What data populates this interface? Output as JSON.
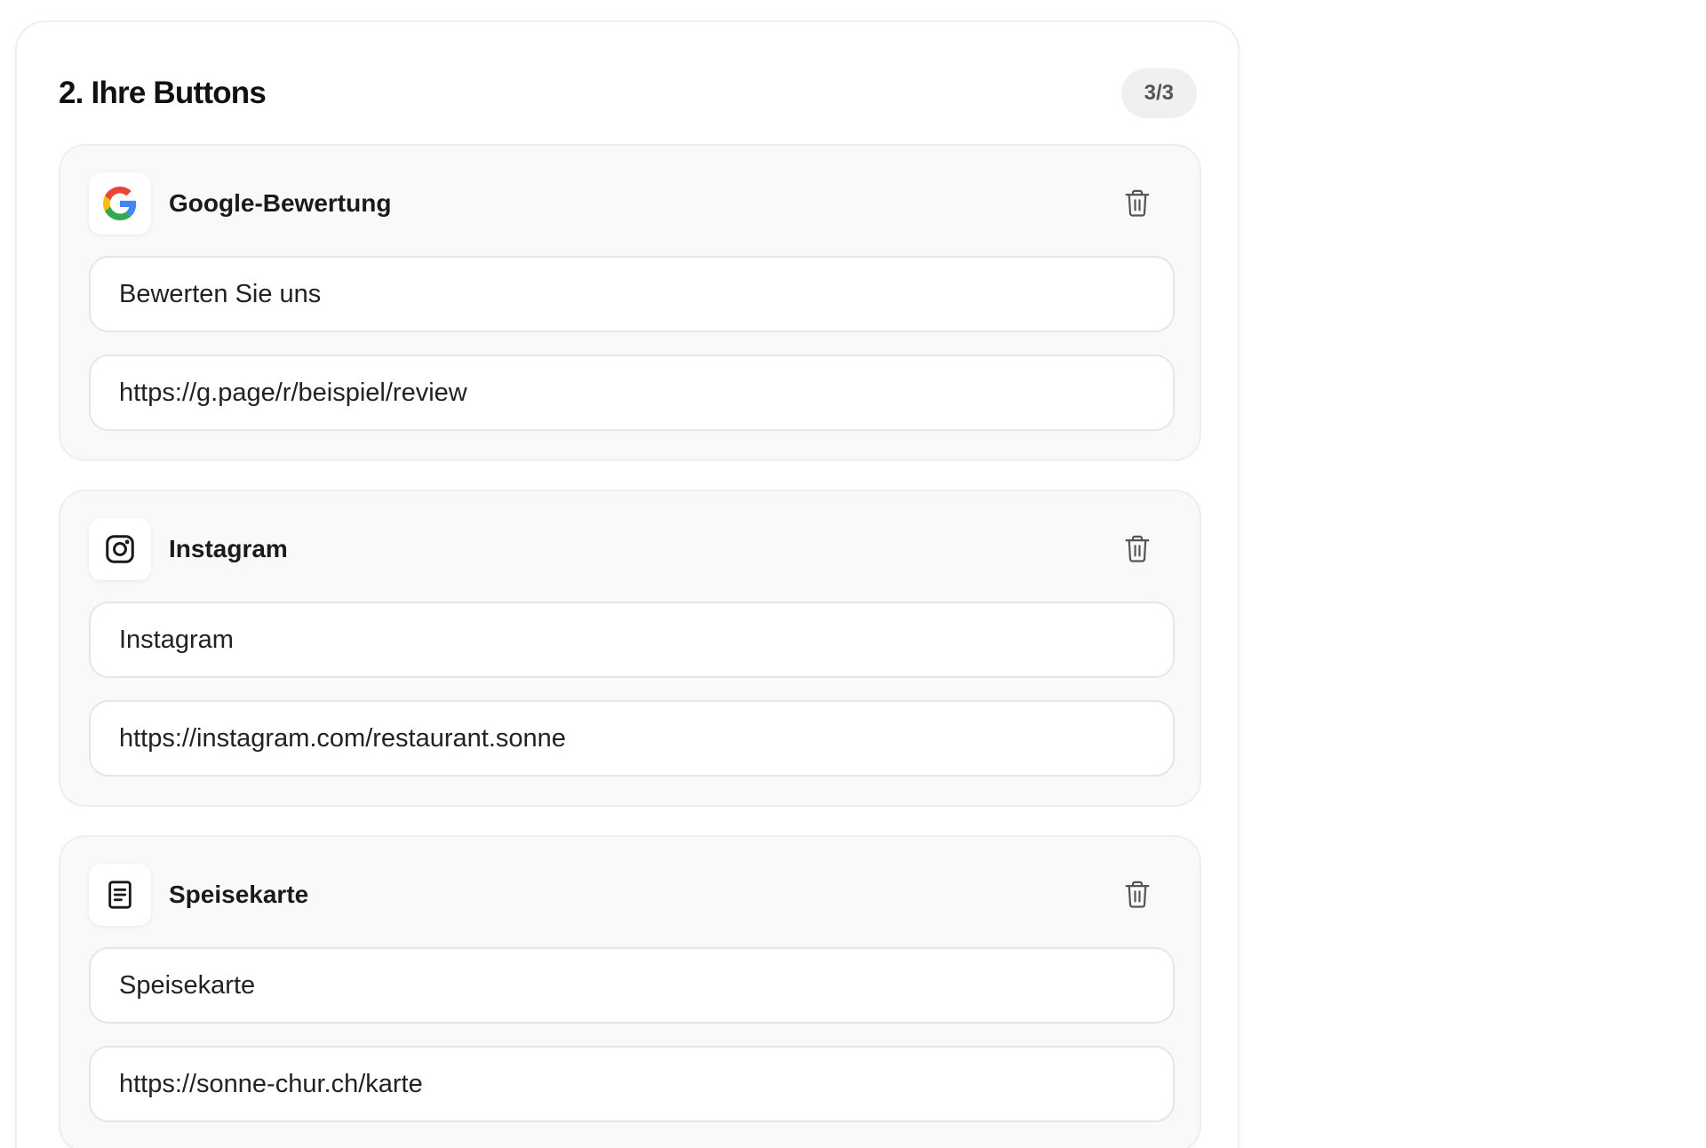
{
  "section": {
    "title": "2. Ihre Buttons",
    "count": "3/3"
  },
  "buttons": [
    {
      "name": "Google-Bewertung",
      "icon": "google-icon",
      "label_value": "Bewerten Sie uns",
      "url_value": "https://g.page/r/beispiel/review"
    },
    {
      "name": "Instagram",
      "icon": "instagram-icon",
      "label_value": "Instagram",
      "url_value": "https://instagram.com/restaurant.sonne"
    },
    {
      "name": "Speisekarte",
      "icon": "document-icon",
      "label_value": "Speisekarte",
      "url_value": "https://sonne-chur.ch/karte"
    }
  ],
  "colors": {
    "google_blue": "#4285F4",
    "google_red": "#EA4335",
    "google_yellow": "#FBBC05",
    "google_green": "#34A853",
    "icon_dark": "#1a1a1a",
    "trash_gray": "#555555"
  }
}
